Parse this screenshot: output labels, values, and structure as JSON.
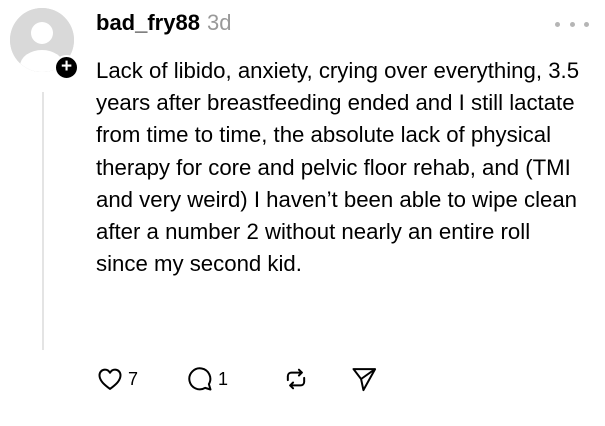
{
  "post": {
    "username": "bad_fry88",
    "timestamp": "3d",
    "follow_badge": "+",
    "text": "Lack of libido, anxiety, crying over everything, 3.5 years after breastfeeding ended and I still lactate from time to time, the absolute lack of physical therapy for core and pelvic floor rehab, and (TMI and very weird) I haven’t been able to wipe clean after a number 2 without nearly an entire roll since my second kid.",
    "like_count": "7",
    "reply_count": "1"
  },
  "icons": {
    "avatar": "default-avatar-icon",
    "follow": "plus-icon",
    "more": "more-horizontal-icon",
    "like": "heart-icon",
    "reply": "comment-icon",
    "repost": "repost-icon",
    "share": "send-icon"
  },
  "colors": {
    "text": "#000000",
    "muted": "#999999",
    "avatar_bg": "#d9d9d9",
    "thread_line": "#e4e4e4"
  }
}
